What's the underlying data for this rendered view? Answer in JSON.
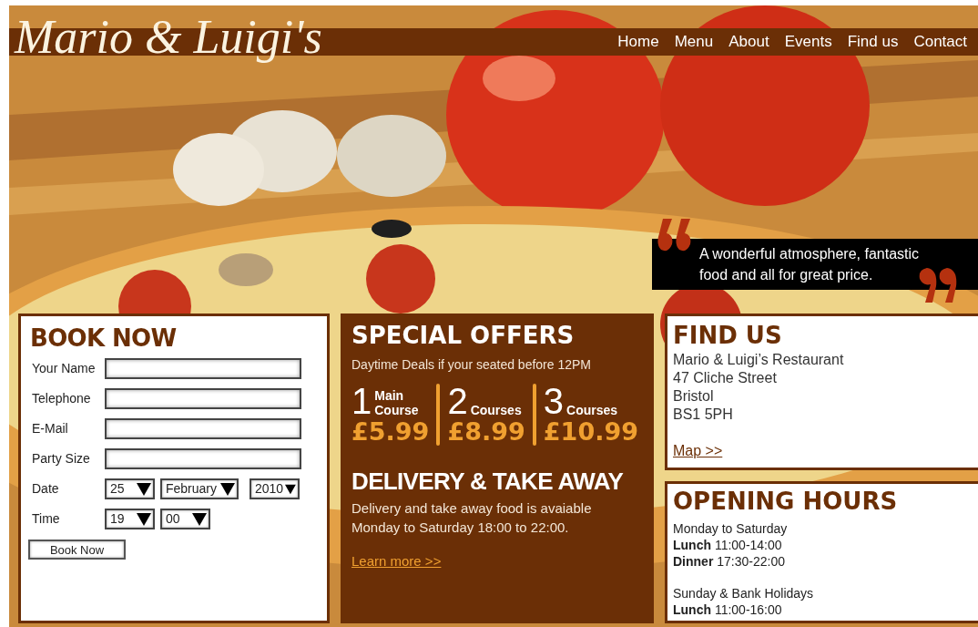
{
  "logo": "Mario & Luigi's",
  "nav": [
    {
      "label": "Home"
    },
    {
      "label": "Menu"
    },
    {
      "label": "About"
    },
    {
      "label": "Events"
    },
    {
      "label": "Find us"
    },
    {
      "label": "Contact"
    }
  ],
  "quote": "A wonderful atmosphere, fantastic food and all for great price.",
  "booking": {
    "title": "BOOK NOW",
    "fields": [
      {
        "label": "Your Name",
        "kind": "text"
      },
      {
        "label": "Telephone",
        "kind": "text"
      },
      {
        "label": "E-Mail",
        "kind": "text"
      },
      {
        "label": "Party Size",
        "kind": "text"
      },
      {
        "label": "Date",
        "kind": "selects",
        "values": [
          "25",
          "February",
          "2010"
        ]
      },
      {
        "label": "Time",
        "kind": "selects",
        "values": [
          "19",
          "00"
        ]
      }
    ],
    "button": "Book Now"
  },
  "offers": {
    "title": "SPECIAL OFFERS",
    "subtitle": "Daytime Deals if your seated before 12PM",
    "deals": [
      {
        "number": "1",
        "label": "Main Course",
        "price": "£5.99"
      },
      {
        "number": "2",
        "label": "Courses",
        "price": "£8.99"
      },
      {
        "number": "3",
        "label": "Courses",
        "price": "£10.99"
      }
    ]
  },
  "delivery": {
    "title": "DELIVERY & TAKE AWAY",
    "text": "Delivery and take away food is avaiable Monday to Saturday 18:00 to 22:00.",
    "link": "Learn more >>"
  },
  "find_us": {
    "title": "FIND US",
    "address": [
      "Mario & Luigi’s Restaurant",
      "47 Cliche Street",
      "Bristol",
      "BS1 5PH"
    ],
    "link": "Map >>"
  },
  "opening_hours": {
    "title": "OPENING HOURS",
    "groups": [
      [
        "Monday to Saturday",
        "**Lunch** 11:00-14:00",
        "**Dinner** 17:30-22:00"
      ],
      [
        "Sunday & Bank Holidays",
        "**Lunch** 11:00-16:00"
      ]
    ]
  }
}
